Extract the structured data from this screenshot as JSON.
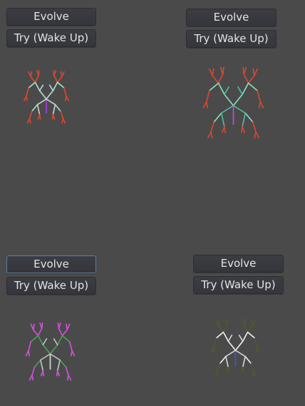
{
  "panels": [
    {
      "id": "top-left",
      "evolve_label": "Evolve",
      "try_label": "Try (Wake Up)",
      "colors": {
        "trunk": "#9b3fd6",
        "inner": "#a8e6c8",
        "mid": "#c9d4cf",
        "outer": "#e0452e"
      }
    },
    {
      "id": "top-right",
      "evolve_label": "Evolve",
      "try_label": "Try (Wake Up)",
      "colors": {
        "trunk": "#b94ad8",
        "inner": "#8ee0c0",
        "mid": "#4fc0a0",
        "outer": "#e0452e"
      }
    },
    {
      "id": "bottom-left",
      "evolve_label": "Evolve",
      "try_label": "Try (Wake Up)",
      "colors": {
        "trunk": "#c9d4cf",
        "inner": "#4aa05a",
        "mid": "#c6c6c6",
        "outer": "#d94fe0"
      }
    },
    {
      "id": "bottom-right",
      "evolve_label": "Evolve",
      "try_label": "Try (Wake Up)",
      "colors": {
        "trunk": "#3b56d6",
        "inner": "#f2f2f2",
        "mid": "#d8d8d8",
        "outer": "#4e5a2e"
      }
    }
  ]
}
